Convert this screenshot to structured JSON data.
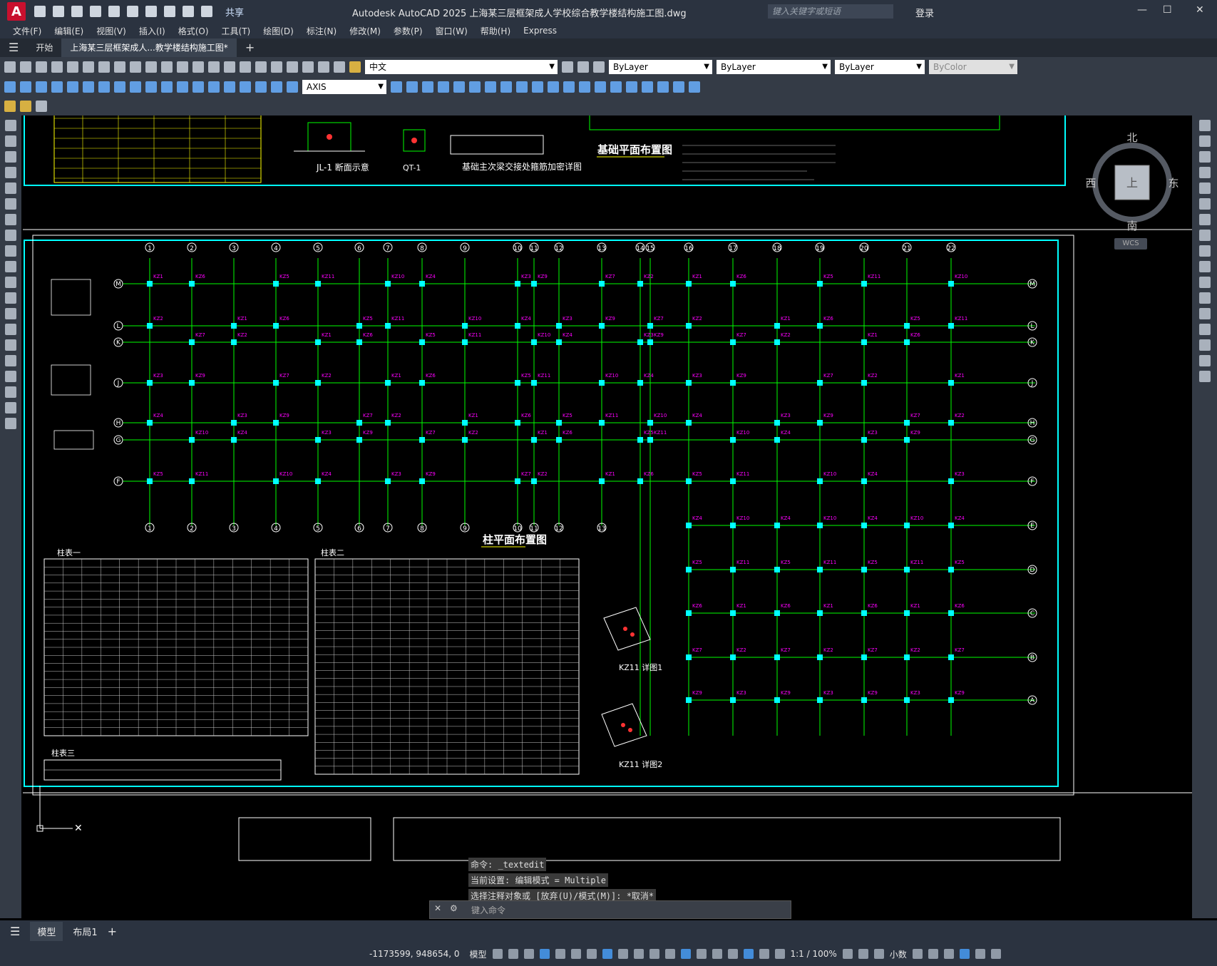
{
  "app": {
    "logo": "A",
    "title": "Autodesk AutoCAD 2025    上海某三层框架成人学校综合教学楼结构施工图.dwg",
    "share": "共享",
    "search_placeholder": "键入关键字或短语",
    "login": "登录"
  },
  "menu": [
    "文件(F)",
    "编辑(E)",
    "视图(V)",
    "插入(I)",
    "格式(O)",
    "工具(T)",
    "绘图(D)",
    "标注(N)",
    "修改(M)",
    "参数(P)",
    "窗口(W)",
    "帮助(H)",
    "Express"
  ],
  "tabs": {
    "start": "开始",
    "file": "上海某三层框架成人...教学楼结构施工图*",
    "add": "+"
  },
  "toolbar": {
    "layer": "中文",
    "color": "ByLayer",
    "linetype": "ByLayer",
    "lineweight": "ByLayer",
    "plotstyle": "ByColor",
    "dimstyle": "AXIS"
  },
  "compass": {
    "n": "北",
    "s": "南",
    "e": "东",
    "w": "西",
    "top": "上",
    "wcs": "WCS"
  },
  "drawing": {
    "foundation_plan": "基础平面布置图",
    "column_plan": "柱平面布置图",
    "jl_detail": "JL-1 断面示意",
    "qt_detail": "QT-1",
    "beam_detail": "基础主次梁交接处箍筋加密详图",
    "table1": "柱表一",
    "table2": "柱表二",
    "table3": "柱表三",
    "kz11a": "KZ11 详图1",
    "kz11b": "KZ11 详图2",
    "axes_top": [
      "1",
      "2",
      "3",
      "4",
      "5",
      "6",
      "7",
      "8",
      "9",
      "10",
      "11",
      "12",
      "13",
      "14",
      "15",
      "16",
      "17",
      "18",
      "19",
      "20",
      "21",
      "22"
    ],
    "axes_left": [
      "M",
      "L",
      "K",
      "J",
      "H",
      "G",
      "F"
    ],
    "axes_right": [
      "M",
      "L",
      "K",
      "J",
      "H",
      "G",
      "F",
      "E",
      "D",
      "C",
      "B",
      "A"
    ],
    "column_labels": [
      "KZ1",
      "KZ2",
      "KZ3",
      "KZ4",
      "KZ5",
      "KZ6",
      "KZ7",
      "KZ9",
      "KZ10",
      "KZ11"
    ]
  },
  "command": {
    "line1": "命令:  _textedit",
    "line2": "当前设置: 编辑模式 = Multiple",
    "line3": "选择注释对象或 [放弃(U)/模式(M)]: *取消*",
    "prompt": "键入命令"
  },
  "layouts": {
    "model": "模型",
    "layout1": "布局1",
    "add": "+"
  },
  "status": {
    "coords": "-1173599, 948654, 0",
    "space": "模型",
    "scale": "1:1 / 100%",
    "units": "小数"
  }
}
